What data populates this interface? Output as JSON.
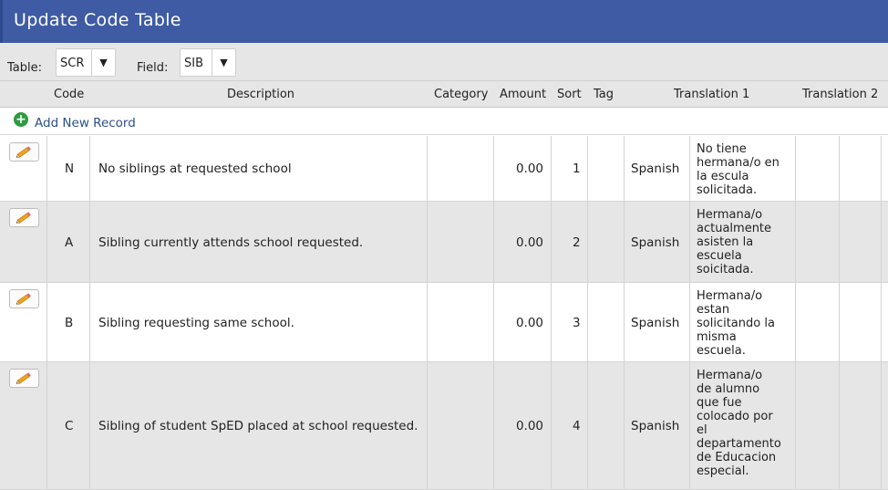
{
  "window": {
    "title": "Update Code Table"
  },
  "filters": {
    "table_label": "Table:",
    "table_value": "SCR",
    "field_label": "Field:",
    "field_value": "SIB"
  },
  "columns": {
    "code": "Code",
    "description": "Description",
    "category": "Category",
    "amount": "Amount",
    "sort": "Sort",
    "tag": "Tag",
    "translation1": "Translation 1",
    "translation2": "Translation 2"
  },
  "add_new_label": "Add New Record",
  "icons": {
    "add": "plus-circle-icon",
    "edit": "pencil-icon"
  },
  "colors": {
    "header_bg": "#3e5ba3",
    "add_icon": "#2e9b42",
    "link": "#2d4f8c"
  },
  "rows": [
    {
      "code": "N",
      "description": "No siblings at requested school",
      "category": "",
      "amount": "0.00",
      "sort": "1",
      "tag": "",
      "language": "Spanish",
      "translation": "No tiene\nhermana/o en\nla escula\nsolicitada."
    },
    {
      "code": "A",
      "description": "Sibling currently attends school requested.",
      "category": "",
      "amount": "0.00",
      "sort": "2",
      "tag": "",
      "language": "Spanish",
      "translation": "Hermana/o\nactualmente\nasisten la\nescuela\nsoicitada."
    },
    {
      "code": "B",
      "description": "Sibling requesting same school.",
      "category": "",
      "amount": "0.00",
      "sort": "3",
      "tag": "",
      "language": "Spanish",
      "translation": "Hermana/o\nestan\nsolicitando la\nmisma\nescuela."
    },
    {
      "code": "C",
      "description": "Sibling of student SpED placed at school requested.",
      "category": "",
      "amount": "0.00",
      "sort": "4",
      "tag": "",
      "language": "Spanish",
      "translation": "Hermana/o\nde alumno\nque fue\ncolocado por\nel\ndepartamento\nde Educacion\nespecial."
    }
  ]
}
